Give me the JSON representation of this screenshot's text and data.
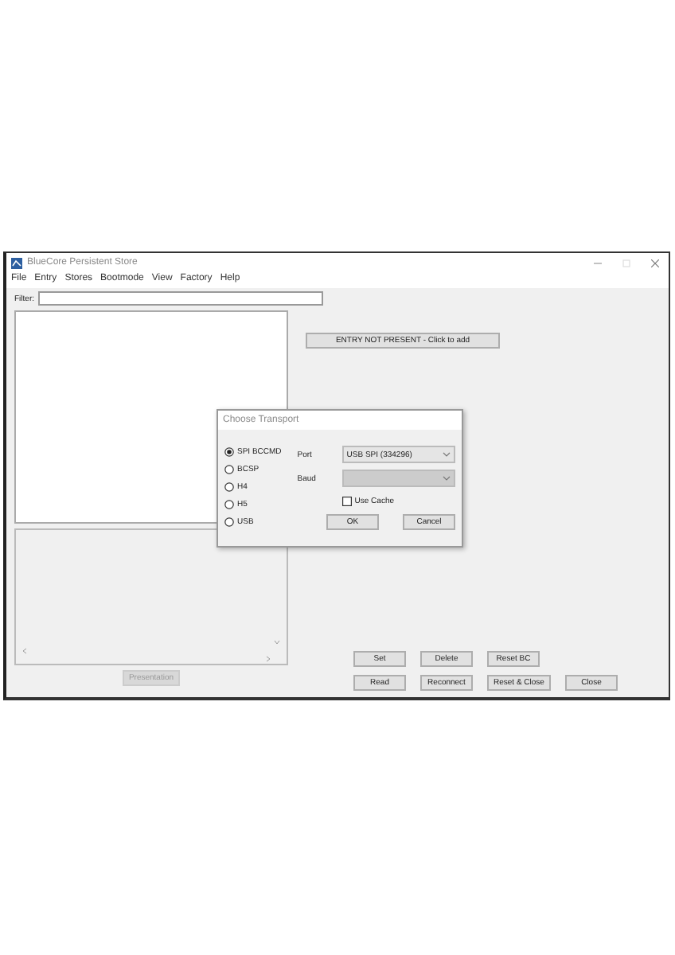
{
  "window": {
    "title": "BlueCore Persistent Store"
  },
  "menu": [
    "File",
    "Entry",
    "Stores",
    "Bootmode",
    "View",
    "Factory",
    "Help"
  ],
  "filter": {
    "label": "Filter:"
  },
  "entry_button": {
    "label": "ENTRY NOT PRESENT - Click to add"
  },
  "presentation_button": {
    "label": "Presentation",
    "disabled": true
  },
  "button_rows": [
    [
      "Set",
      "Delete",
      "Reset BC"
    ],
    [
      "Read",
      "Reconnect",
      "Reset & Close",
      "Close"
    ]
  ],
  "dialog": {
    "title": "Choose Transport",
    "transports": [
      {
        "label": "SPI BCCMD",
        "selected": true
      },
      {
        "label": "BCSP",
        "selected": false
      },
      {
        "label": "H4",
        "selected": false
      },
      {
        "label": "H5",
        "selected": false
      },
      {
        "label": "USB",
        "selected": false
      }
    ],
    "port": {
      "label": "Port",
      "value": "USB SPI (334296)",
      "disabled": false
    },
    "baud": {
      "label": "Baud",
      "disabled": true
    },
    "use_cache": {
      "label": "Use Cache",
      "checked": false
    },
    "buttons": [
      "OK",
      "Cancel"
    ]
  }
}
